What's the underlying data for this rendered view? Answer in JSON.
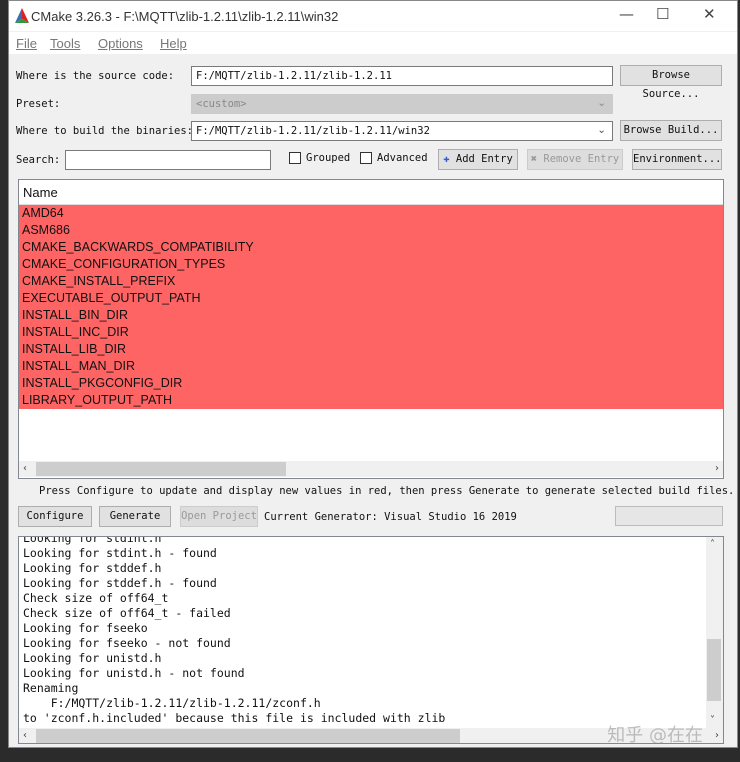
{
  "window": {
    "title": "CMake 3.26.3 - F:\\MQTT\\zlib-1.2.11\\zlib-1.2.11\\win32"
  },
  "menu": [
    "File",
    "Tools",
    "Options",
    "Help"
  ],
  "source": {
    "label": "Where is the source code:",
    "value": "F:/MQTT/zlib-1.2.11/zlib-1.2.11",
    "browse": "Browse Source..."
  },
  "preset": {
    "label": "Preset:",
    "value": "<custom>"
  },
  "build": {
    "label": "Where to build the binaries:",
    "value": "F:/MQTT/zlib-1.2.11/zlib-1.2.11/win32",
    "browse": "Browse Build..."
  },
  "search": {
    "label": "Search:",
    "value": "",
    "grouped": "Grouped",
    "advanced": "Advanced",
    "add_entry": "Add Entry",
    "remove_entry": "Remove Entry",
    "environment": "Environment..."
  },
  "table": {
    "header": "Name",
    "rows": [
      "AMD64",
      "ASM686",
      "CMAKE_BACKWARDS_COMPATIBILITY",
      "CMAKE_CONFIGURATION_TYPES",
      "CMAKE_INSTALL_PREFIX",
      "EXECUTABLE_OUTPUT_PATH",
      "INSTALL_BIN_DIR",
      "INSTALL_INC_DIR",
      "INSTALL_LIB_DIR",
      "INSTALL_MAN_DIR",
      "INSTALL_PKGCONFIG_DIR",
      "LIBRARY_OUTPUT_PATH"
    ],
    "highlight": "#ff6464"
  },
  "info": "Press Configure to update and display new values in red, then press Generate to generate selected build files.",
  "actions": {
    "configure": "Configure",
    "generate": "Generate",
    "open_project": "Open Project",
    "generator": "Current Generator: Visual Studio 16 2019"
  },
  "output": [
    "Looking for stdint.h",
    "Looking for stdint.h - found",
    "Looking for stddef.h",
    "Looking for stddef.h - found",
    "Check size of off64_t",
    "Check size of off64_t - failed",
    "Looking for fseeko",
    "Looking for fseeko - not found",
    "Looking for unistd.h",
    "Looking for unistd.h - not found",
    "Renaming",
    "    F:/MQTT/zlib-1.2.11/zlib-1.2.11/zconf.h",
    "to 'zconf.h.included' because this file is included with zlib"
  ],
  "watermark": "知乎 @在在"
}
